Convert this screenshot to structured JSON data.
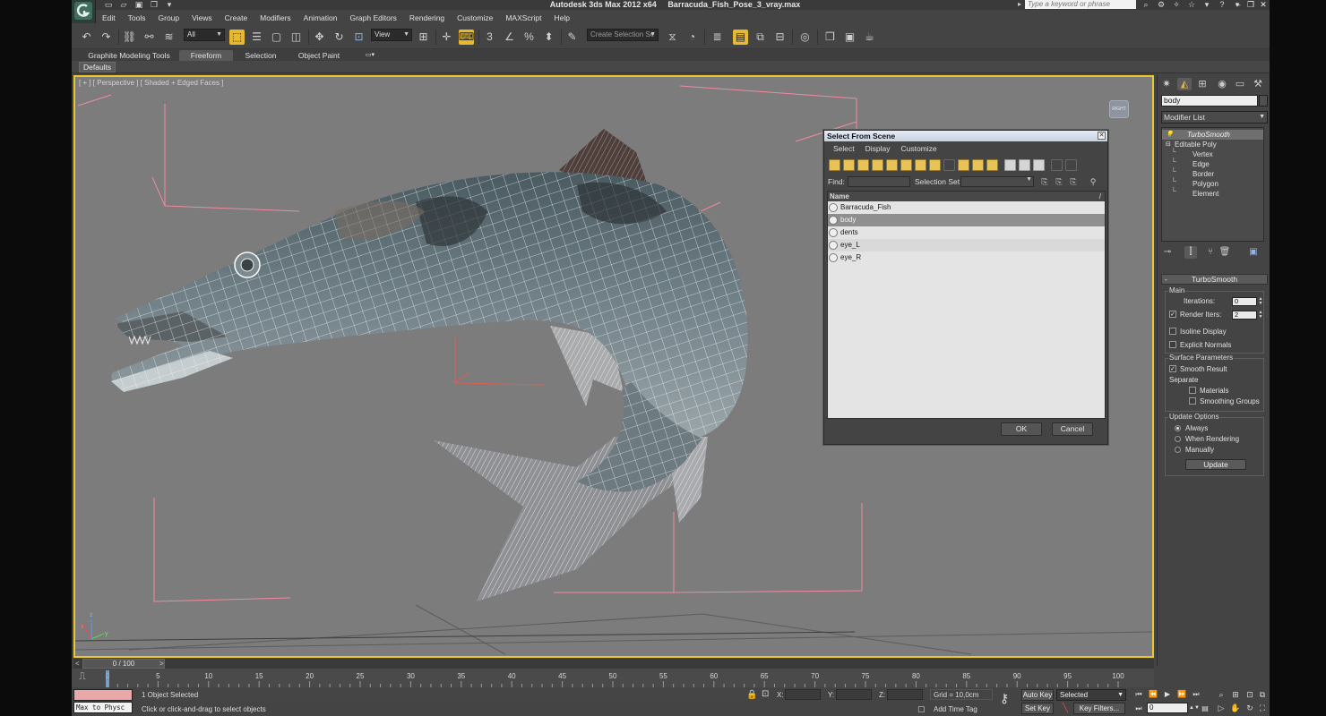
{
  "window": {
    "app_name": "Autodesk 3ds Max  2012 x64",
    "file_name": "Barracuda_Fish_Pose_3_vray.max",
    "help_search_placeholder": "Type a keyword or phrase"
  },
  "menus": [
    "Edit",
    "Tools",
    "Group",
    "Views",
    "Create",
    "Modifiers",
    "Animation",
    "Graph Editors",
    "Rendering",
    "Customize",
    "MAXScript",
    "Help"
  ],
  "toolbar": {
    "selection_filter": "All",
    "reference_coord": "View",
    "named_selection_placeholder": "Create Selection Se"
  },
  "ribbon": {
    "tabs": [
      "Graphite Modeling Tools",
      "Freeform",
      "Selection",
      "Object Paint"
    ],
    "active_tab": "Freeform",
    "sub_tab": "Defaults"
  },
  "viewport": {
    "label": "[ + ] [ Perspective ] [ Shaded + Edged Faces ]",
    "viewcube_label": "RIGHT"
  },
  "dialog": {
    "title": "Select From Scene",
    "menus": [
      "Select",
      "Display",
      "Customize"
    ],
    "find_label": "Find:",
    "find_value": "",
    "selection_set_label": "Selection Set:",
    "column_header": "Name",
    "items": [
      {
        "name": "Barracuda_Fish",
        "selected": false
      },
      {
        "name": "body",
        "selected": true
      },
      {
        "name": "dents",
        "selected": false
      },
      {
        "name": "eye_L",
        "selected": false
      },
      {
        "name": "eye_R",
        "selected": false
      }
    ],
    "ok_label": "OK",
    "cancel_label": "Cancel"
  },
  "command_panel": {
    "object_name": "body",
    "modifier_list": "Modifier List",
    "stack": [
      {
        "label": "TurboSmooth",
        "level": 0,
        "active": true
      },
      {
        "label": "Editable Poly",
        "level": 0,
        "active": false
      },
      {
        "label": "Vertex",
        "level": 1,
        "active": false
      },
      {
        "label": "Edge",
        "level": 1,
        "active": false
      },
      {
        "label": "Border",
        "level": 1,
        "active": false
      },
      {
        "label": "Polygon",
        "level": 1,
        "active": false
      },
      {
        "label": "Element",
        "level": 1,
        "active": false
      }
    ],
    "rollout_title": "TurboSmooth",
    "main": {
      "group_label": "Main",
      "iterations_label": "Iterations:",
      "iterations_value": "0",
      "render_iters_label": "Render Iters:",
      "render_iters_value": "2",
      "render_iters_checked": true,
      "isoline_label": "Isoline Display",
      "isoline_checked": false,
      "explicit_normals_label": "Explicit Normals",
      "explicit_normals_checked": false
    },
    "surface": {
      "group_label": "Surface Parameters",
      "smooth_result_label": "Smooth Result",
      "smooth_result_checked": true,
      "separate_label": "Separate",
      "materials_label": "Materials",
      "materials_checked": false,
      "smoothing_groups_label": "Smoothing Groups",
      "smoothing_groups_checked": false
    },
    "update": {
      "group_label": "Update Options",
      "options": [
        "Always",
        "When Rendering",
        "Manually"
      ],
      "selected": "Always",
      "button_label": "Update"
    }
  },
  "timeline": {
    "slider_label": "0 / 100",
    "ticks": [
      0,
      5,
      10,
      15,
      20,
      25,
      30,
      35,
      40,
      45,
      50,
      55,
      60,
      65,
      70,
      75,
      80,
      85,
      90,
      95,
      100
    ],
    "max_frame": 100
  },
  "status": {
    "maxscript_text": "Max to Physc",
    "selection_info": "1 Object Selected",
    "prompt": "Click or click-and-drag to select objects",
    "x_label": "X:",
    "y_label": "Y:",
    "z_label": "Z:",
    "grid": "Grid = 10,0cm",
    "add_time_tag": "Add Time Tag",
    "auto_key": "Auto Key",
    "set_key": "Set Key",
    "selected_mode": "Selected",
    "key_filters": "Key Filters...",
    "current_frame": "0"
  },
  "colors": {
    "viewport_border": "#e9c82d",
    "viewport_bg": "#7c7c7c",
    "selection_highlight": "#8f8f8f",
    "accent_orange": "#e8a23a"
  }
}
